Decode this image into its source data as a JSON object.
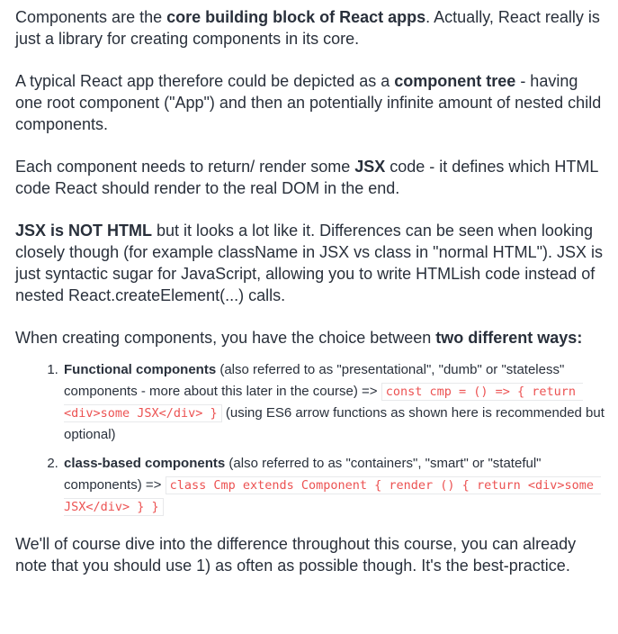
{
  "p1": {
    "t1": "Components are the ",
    "b1": "core building block of React apps",
    "t2": ". Actually, React really is just a library for creating components in its core."
  },
  "p2": {
    "t1": "A typical React app therefore could be depicted as a ",
    "b1": "component tree",
    "t2": " - having one root component (\"App\") and then an potentially infinite amount of nested child components."
  },
  "p3": {
    "t1": "Each component needs to return/ render some ",
    "b1": "JSX",
    "t2": " code - it defines which HTML code React should render to the real DOM in the end."
  },
  "p4": {
    "b1": "JSX is NOT HTML",
    "t1": " but it looks a lot like it. Differences can be seen when looking closely though (for example className in JSX vs class in \"normal HTML\"). JSX is just syntactic sugar for JavaScript, allowing you to write HTMLish code instead of nested React.createElement(...) calls."
  },
  "p5": {
    "t1": "When creating components, you have the choice between ",
    "b1": "two different ways:"
  },
  "ways": [
    {
      "title": "Functional components",
      "text": " (also referred to as \"presentational\", \"dumb\" or \"stateless\" components - more about this later in the course) => ",
      "code": "const cmp = () => { return <div>some JSX</div> }",
      "tail": " (using ES6 arrow functions as shown here is recommended but optional)"
    },
    {
      "title": "class-based components",
      "text": " (also referred to as \"containers\", \"smart\" or \"stateful\" components) => ",
      "code": "class Cmp extends Component { render () { return <div>some JSX</div> } }",
      "tail": ""
    }
  ],
  "p6": {
    "t1": "We'll of course dive into the difference throughout this course, you can already note that you should use 1) as often as possible though. It's the best-practice."
  },
  "colors": {
    "text": "#29303b",
    "code": "#ec5252",
    "code_border": "#e8e9eb"
  }
}
